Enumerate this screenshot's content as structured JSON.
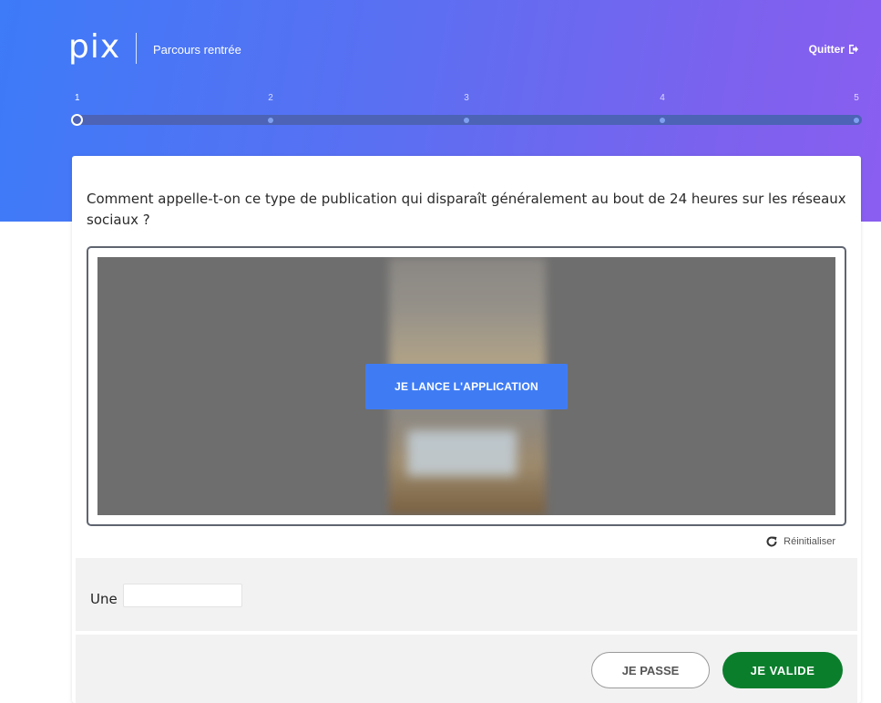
{
  "header": {
    "logo_text": "pix",
    "course_title": "Parcours rentrée",
    "quit_label": "Quitter",
    "quit_icon": "sign-out-icon"
  },
  "progress": {
    "steps": [
      "1",
      "2",
      "3",
      "4",
      "5"
    ],
    "current_step": 1,
    "colors": {
      "track": "#4c63b6",
      "dot": "#7fa0f0"
    }
  },
  "challenge": {
    "question": "Comment appelle-t-on ce type de publication qui disparaît généralement au bout de 24 heures sur les réseaux sociaux ?",
    "launch_button_label": "JE LANCE L'APPLICATION",
    "reset_label": "Réinitialiser",
    "reset_icon": "redo-icon"
  },
  "answer": {
    "prefix": "Une",
    "input_value": ""
  },
  "actions": {
    "skip_label": "JE PASSE",
    "validate_label": "JE VALIDE"
  },
  "colors": {
    "gradient_start": "#3d7bf8",
    "gradient_end": "#8a5ef0",
    "primary_button": "#3f7cf4",
    "validate_button": "#0b7e2c"
  }
}
